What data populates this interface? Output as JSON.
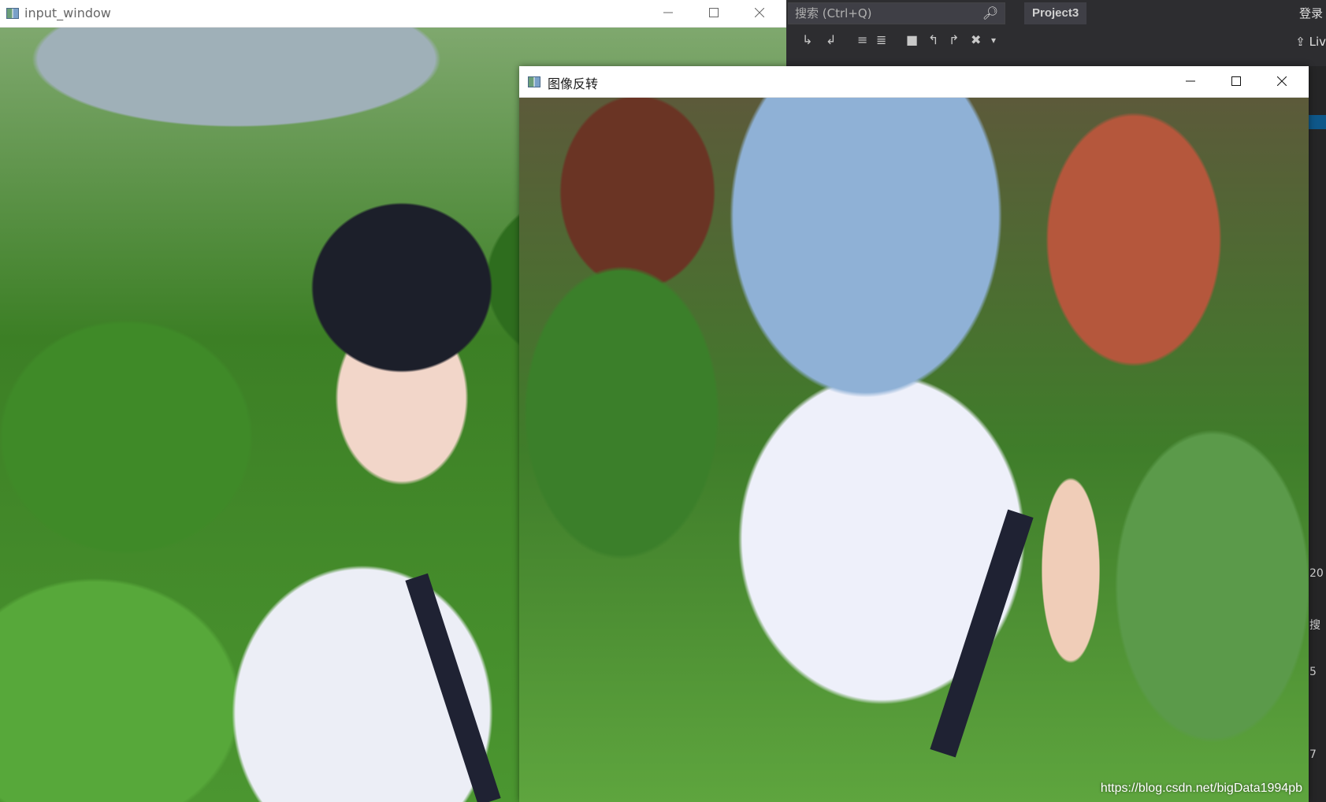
{
  "ide": {
    "search_placeholder": "搜索 (Ctrl+Q)",
    "project_name": "Project3",
    "login_label": "登录",
    "live_label": "Liv",
    "side_fragments": [
      "20",
      "搜",
      "5",
      "7"
    ]
  },
  "input_window": {
    "title": "input_window",
    "image_description": "photo"
  },
  "flip_window": {
    "title": "图像反转",
    "watermark": "https://blog.csdn.net/bigData1994pb"
  },
  "icons": {
    "minimize": "minimize-icon",
    "maximize": "maximize-icon",
    "close": "close-icon",
    "search": "search-icon"
  },
  "colors": {
    "ide_bg": "#2d2d30",
    "titlebar": "#ffffff",
    "accent": "#007acc"
  }
}
